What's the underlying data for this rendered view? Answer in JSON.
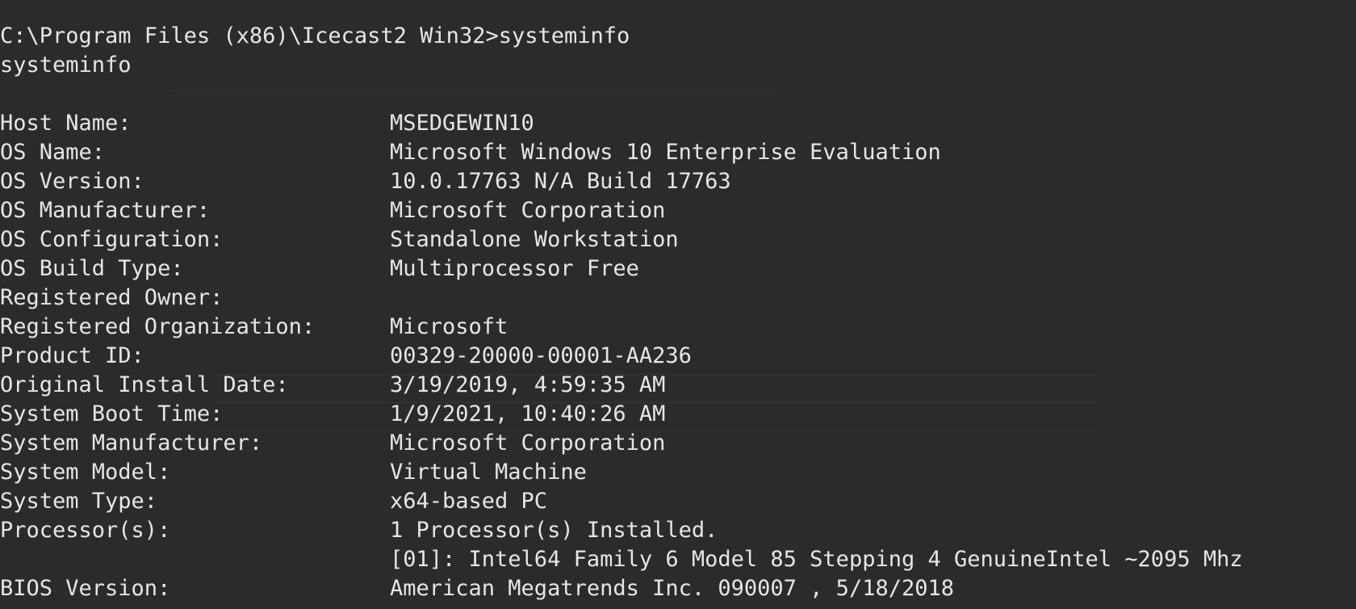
{
  "window": {
    "prompt_line": "C:\\Program Files (x86)\\Icecast2 Win32>systeminfo",
    "echo_line": "systeminfo"
  },
  "info": [
    {
      "label": "Host Name:",
      "value": "MSEDGEWIN10"
    },
    {
      "label": "OS Name:",
      "value": "Microsoft Windows 10 Enterprise Evaluation"
    },
    {
      "label": "OS Version:",
      "value": "10.0.17763 N/A Build 17763"
    },
    {
      "label": "OS Manufacturer:",
      "value": "Microsoft Corporation"
    },
    {
      "label": "OS Configuration:",
      "value": "Standalone Workstation"
    },
    {
      "label": "OS Build Type:",
      "value": "Multiprocessor Free"
    },
    {
      "label": "Registered Owner:",
      "value": ""
    },
    {
      "label": "Registered Organization:",
      "value": "Microsoft"
    },
    {
      "label": "Product ID:",
      "value": "00329-20000-00001-AA236"
    },
    {
      "label": "Original Install Date:",
      "value": "3/19/2019, 4:59:35 AM"
    },
    {
      "label": "System Boot Time:",
      "value": "1/9/2021, 10:40:26 AM"
    },
    {
      "label": "System Manufacturer:",
      "value": "Microsoft Corporation"
    },
    {
      "label": "System Model:",
      "value": "Virtual Machine"
    },
    {
      "label": "System Type:",
      "value": "x64-based PC"
    },
    {
      "label": "Processor(s):",
      "value": "1 Processor(s) Installed."
    },
    {
      "label": "",
      "value": "[01]: Intel64 Family 6 Model 85 Stepping 4 GenuineIntel ~2095 Mhz"
    },
    {
      "label": "BIOS Version:",
      "value": "American Megatrends Inc. 090007 , 5/18/2018"
    }
  ]
}
